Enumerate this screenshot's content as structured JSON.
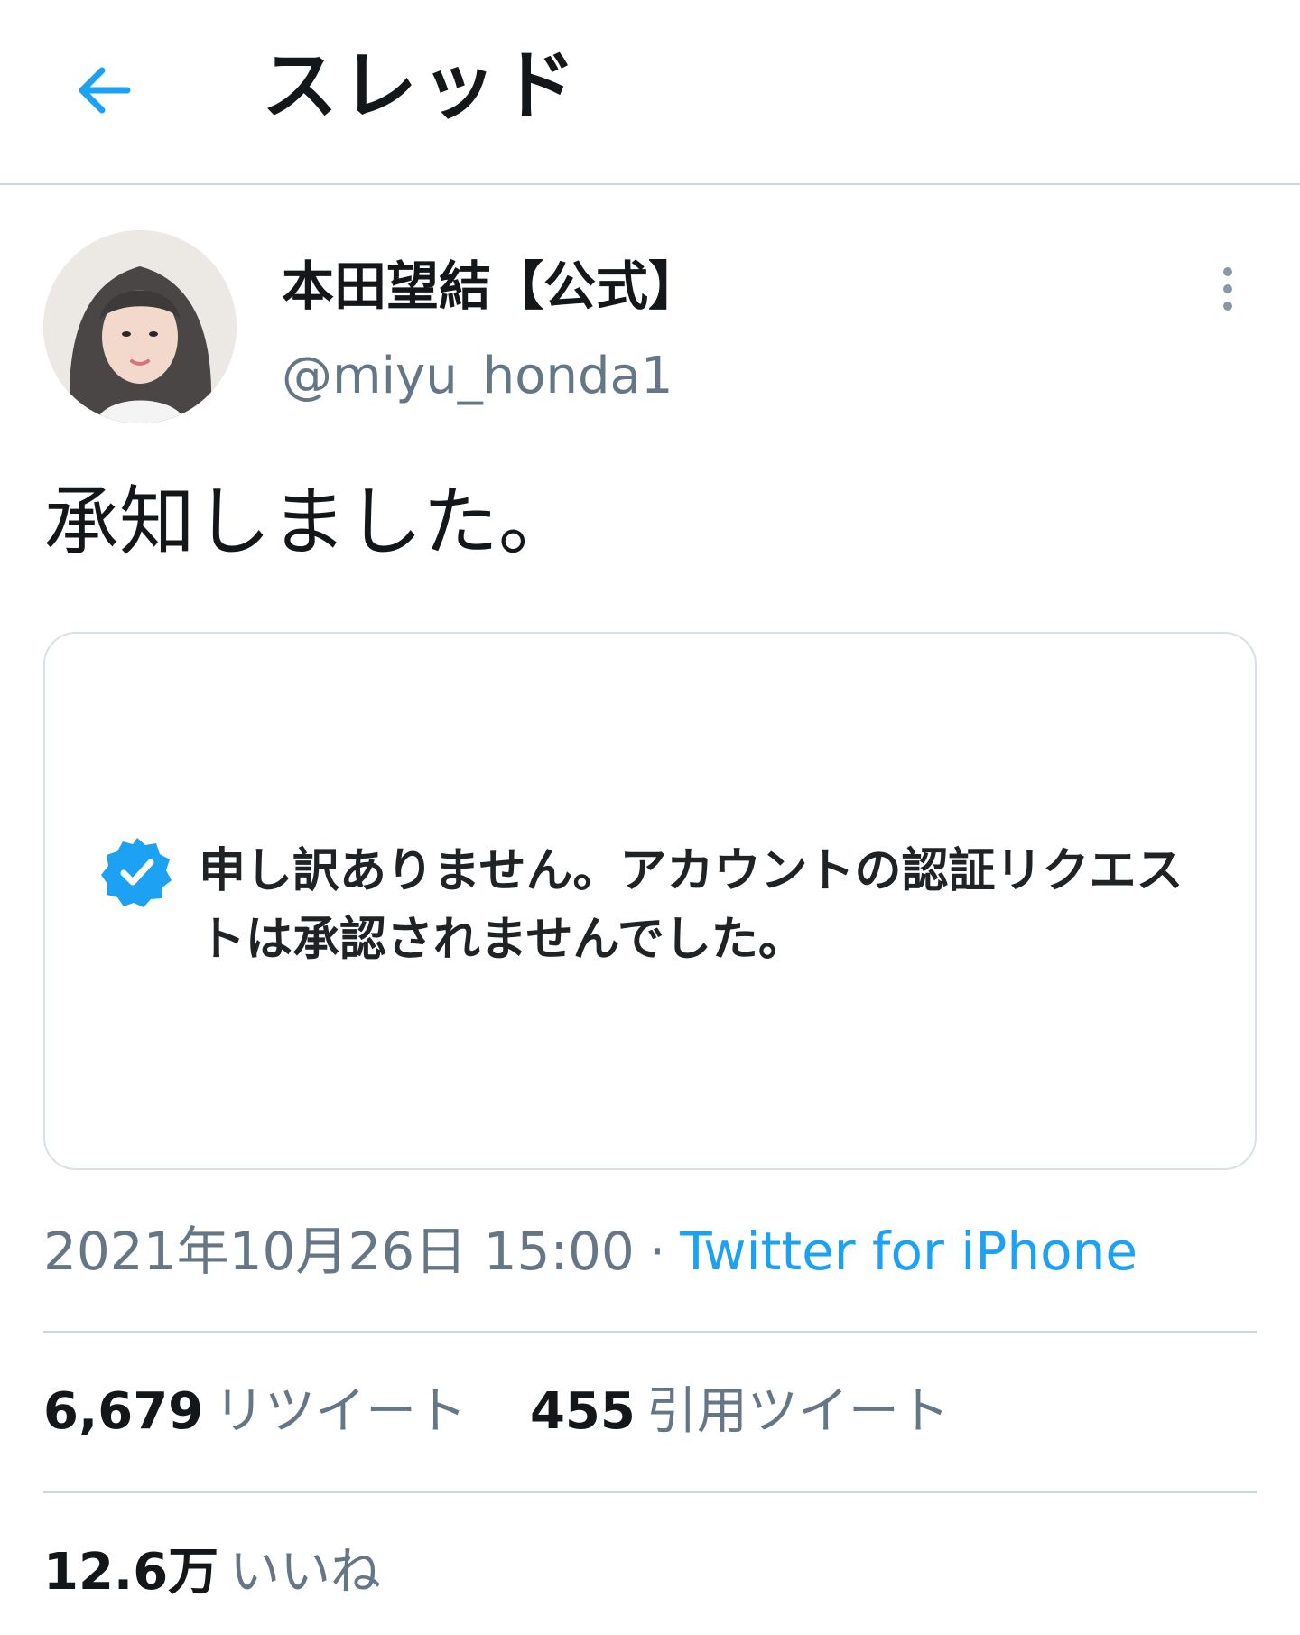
{
  "header": {
    "title": "スレッド",
    "back_icon": "arrow-left-icon"
  },
  "tweet": {
    "display_name": "本田望結【公式】",
    "handle": "@miyu_honda1",
    "text": "承知しました。",
    "image_text": "申し訳ありません。アカウントの認証リクエストは承認されませんでした。",
    "timestamp": "2021年10月26日 15:00",
    "separator": "·",
    "source": "Twitter for iPhone"
  },
  "stats": {
    "retweets_count": "6,679",
    "retweets_label": "リツイート",
    "quotes_count": "455",
    "quotes_label": "引用ツイート",
    "likes_count": "12.6万",
    "likes_label": "いいね"
  },
  "colors": {
    "accent": "#1da1f2",
    "secondary_text": "#657786",
    "primary_text": "#14171a",
    "border": "#ccd6dd"
  }
}
